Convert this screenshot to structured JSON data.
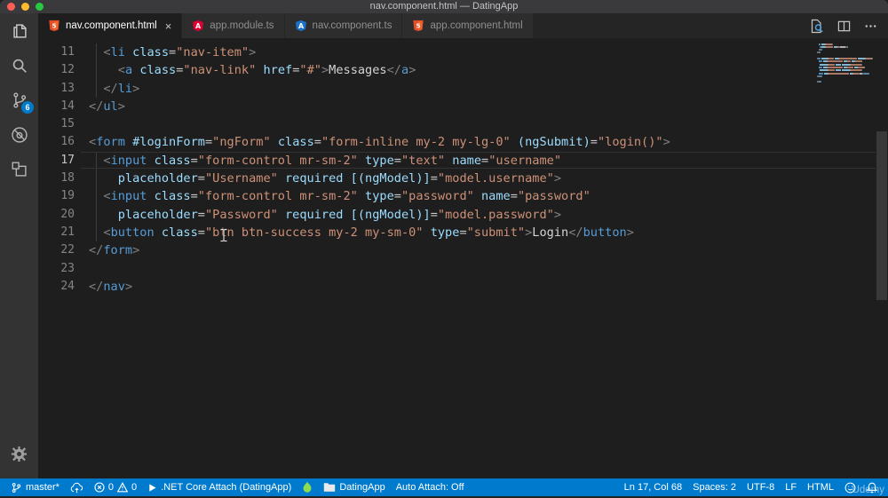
{
  "colors": {
    "accent": "#007acc",
    "editor_bg": "#1e1e1e",
    "activity_bg": "#333333",
    "tab_bg": "#2d2d2d",
    "tabbar_bg": "#252526",
    "titlebar_bg": "#3a3a3c",
    "tok": {
      "p": "#808080",
      "tag": "#569cd6",
      "attr": "#9cdcfe",
      "str": "#ce9178",
      "txt": "#d4d4d4",
      "eq": "#c8c8c8"
    },
    "html_icon": "#e44d26",
    "angular_red": "#dd0031",
    "angular_blue": "#1a73c9",
    "flame_green": "#8bdc4e"
  },
  "window": {
    "title": "nav.component.html — DatingApp"
  },
  "activity_bar": {
    "items": [
      {
        "name": "explorer",
        "icon": "files-icon"
      },
      {
        "name": "search",
        "icon": "search-icon"
      },
      {
        "name": "source-control",
        "icon": "source-control-icon",
        "badge": "6"
      },
      {
        "name": "debug",
        "icon": "debug-icon"
      },
      {
        "name": "extensions",
        "icon": "extensions-icon"
      }
    ],
    "bottom": [
      {
        "name": "settings",
        "icon": "gear-icon"
      }
    ]
  },
  "tab_bar": {
    "tabs": [
      {
        "label": "nav.component.html",
        "icon": "html-file-icon",
        "active": true,
        "close": "×"
      },
      {
        "label": "app.module.ts",
        "icon": "angular-red-icon",
        "active": false
      },
      {
        "label": "nav.component.ts",
        "icon": "angular-blue-icon",
        "active": false
      },
      {
        "label": "app.component.html",
        "icon": "html-file-icon",
        "active": false
      }
    ],
    "actions": [
      {
        "name": "open-preview",
        "icon": "preview-icon"
      },
      {
        "name": "split-editor",
        "icon": "split-editor-icon"
      },
      {
        "name": "more-actions",
        "icon": "ellipsis-icon"
      }
    ]
  },
  "editor": {
    "current_line": "17",
    "lines": [
      {
        "num": "11",
        "guide": true,
        "tokens": [
          [
            "ws",
            "  "
          ],
          [
            "p",
            "<"
          ],
          [
            "tag",
            "li"
          ],
          [
            "ws",
            " "
          ],
          [
            "attr",
            "class"
          ],
          [
            "eq",
            "="
          ],
          [
            "str",
            "\"nav-item\""
          ],
          [
            "p",
            ">"
          ]
        ]
      },
      {
        "num": "12",
        "guide": true,
        "tokens": [
          [
            "ws",
            "    "
          ],
          [
            "p",
            "<"
          ],
          [
            "tag",
            "a"
          ],
          [
            "ws",
            " "
          ],
          [
            "attr",
            "class"
          ],
          [
            "eq",
            "="
          ],
          [
            "str",
            "\"nav-link\""
          ],
          [
            "ws",
            " "
          ],
          [
            "attr",
            "href"
          ],
          [
            "eq",
            "="
          ],
          [
            "str",
            "\"#\""
          ],
          [
            "p",
            ">"
          ],
          [
            "txt",
            "Messages"
          ],
          [
            "p",
            "</"
          ],
          [
            "tag",
            "a"
          ],
          [
            "p",
            ">"
          ]
        ]
      },
      {
        "num": "13",
        "guide": true,
        "tokens": [
          [
            "ws",
            "  "
          ],
          [
            "p",
            "</"
          ],
          [
            "tag",
            "li"
          ],
          [
            "p",
            ">"
          ]
        ]
      },
      {
        "num": "14",
        "guide": false,
        "tokens": [
          [
            "p",
            "</"
          ],
          [
            "tag",
            "ul"
          ],
          [
            "p",
            ">"
          ]
        ]
      },
      {
        "num": "15",
        "guide": false,
        "tokens": []
      },
      {
        "num": "16",
        "guide": false,
        "tokens": [
          [
            "p",
            "<"
          ],
          [
            "tag",
            "form"
          ],
          [
            "ws",
            " "
          ],
          [
            "attr",
            "#loginForm"
          ],
          [
            "eq",
            "="
          ],
          [
            "str",
            "\"ngForm\""
          ],
          [
            "ws",
            " "
          ],
          [
            "attr",
            "class"
          ],
          [
            "eq",
            "="
          ],
          [
            "str",
            "\"form-inline my-2 my-lg-0\""
          ],
          [
            "ws",
            " "
          ],
          [
            "attr",
            "(ngSubmit)"
          ],
          [
            "eq",
            "="
          ],
          [
            "str",
            "\"login()\""
          ],
          [
            "p",
            ">"
          ]
        ]
      },
      {
        "num": "17",
        "guide": true,
        "tokens": [
          [
            "ws",
            "  "
          ],
          [
            "p",
            "<"
          ],
          [
            "tag",
            "input"
          ],
          [
            "ws",
            " "
          ],
          [
            "attr",
            "class"
          ],
          [
            "eq",
            "="
          ],
          [
            "str",
            "\"form-control mr-sm-2\""
          ],
          [
            "ws",
            " "
          ],
          [
            "attr",
            "type"
          ],
          [
            "eq",
            "="
          ],
          [
            "str",
            "\"text\""
          ],
          [
            "ws",
            " "
          ],
          [
            "attr",
            "name"
          ],
          [
            "eq",
            "="
          ],
          [
            "str",
            "\"username\""
          ]
        ]
      },
      {
        "num": "18",
        "guide": true,
        "tokens": [
          [
            "ws",
            "    "
          ],
          [
            "attr",
            "placeholder"
          ],
          [
            "eq",
            "="
          ],
          [
            "str",
            "\"Username\""
          ],
          [
            "ws",
            " "
          ],
          [
            "attr",
            "required"
          ],
          [
            "ws",
            " "
          ],
          [
            "attr",
            "[(ngModel)]"
          ],
          [
            "eq",
            "="
          ],
          [
            "str",
            "\"model.username\""
          ],
          [
            "p",
            ">"
          ]
        ]
      },
      {
        "num": "19",
        "guide": true,
        "tokens": [
          [
            "ws",
            "  "
          ],
          [
            "p",
            "<"
          ],
          [
            "tag",
            "input"
          ],
          [
            "ws",
            " "
          ],
          [
            "attr",
            "class"
          ],
          [
            "eq",
            "="
          ],
          [
            "str",
            "\"form-control mr-sm-2\""
          ],
          [
            "ws",
            " "
          ],
          [
            "attr",
            "type"
          ],
          [
            "eq",
            "="
          ],
          [
            "str",
            "\"password\""
          ],
          [
            "ws",
            " "
          ],
          [
            "attr",
            "name"
          ],
          [
            "eq",
            "="
          ],
          [
            "str",
            "\"password\""
          ]
        ]
      },
      {
        "num": "20",
        "guide": true,
        "tokens": [
          [
            "ws",
            "    "
          ],
          [
            "attr",
            "placeholder"
          ],
          [
            "eq",
            "="
          ],
          [
            "str",
            "\"Password\""
          ],
          [
            "ws",
            " "
          ],
          [
            "attr",
            "required"
          ],
          [
            "ws",
            " "
          ],
          [
            "attr",
            "[(ngModel)]"
          ],
          [
            "eq",
            "="
          ],
          [
            "str",
            "\"model.password\""
          ],
          [
            "p",
            ">"
          ]
        ]
      },
      {
        "num": "21",
        "guide": true,
        "tokens": [
          [
            "ws",
            "  "
          ],
          [
            "p",
            "<"
          ],
          [
            "tag",
            "button"
          ],
          [
            "ws",
            " "
          ],
          [
            "attr",
            "class"
          ],
          [
            "eq",
            "="
          ],
          [
            "str",
            "\"btn btn-success my-2 my-sm-0\""
          ],
          [
            "ws",
            " "
          ],
          [
            "attr",
            "type"
          ],
          [
            "eq",
            "="
          ],
          [
            "str",
            "\"submit\""
          ],
          [
            "p",
            ">"
          ],
          [
            "txt",
            "Login"
          ],
          [
            "p",
            "</"
          ],
          [
            "tag",
            "button"
          ],
          [
            "p",
            ">"
          ]
        ]
      },
      {
        "num": "22",
        "guide": false,
        "tokens": [
          [
            "p",
            "</"
          ],
          [
            "tag",
            "form"
          ],
          [
            "p",
            ">"
          ]
        ]
      },
      {
        "num": "23",
        "guide": false,
        "tokens": []
      },
      {
        "num": "24",
        "guide": false,
        "tokens": [
          [
            "p",
            "</"
          ],
          [
            "tag",
            "nav"
          ],
          [
            "p",
            ">"
          ]
        ]
      }
    ]
  },
  "status_bar": {
    "left": [
      {
        "name": "git-branch",
        "segments": [
          {
            "icon": "branch-icon"
          },
          {
            "text": "master*"
          }
        ]
      },
      {
        "name": "sync-changes",
        "segments": [
          {
            "icon": "cloud-upload-icon"
          }
        ]
      },
      {
        "name": "problems",
        "segments": [
          {
            "icon": "error-circle-icon"
          },
          {
            "text": "0"
          },
          {
            "icon": "warning-triangle-icon"
          },
          {
            "text": "0"
          }
        ]
      },
      {
        "name": "debug-config",
        "segments": [
          {
            "icon": "play-icon"
          },
          {
            "text": ".NET Core Attach (DatingApp)"
          }
        ]
      },
      {
        "name": "angular-status",
        "segments": [
          {
            "icon": "flame-icon"
          }
        ]
      },
      {
        "name": "workspace-folder",
        "segments": [
          {
            "icon": "folder-icon"
          },
          {
            "text": "DatingApp"
          }
        ]
      },
      {
        "name": "auto-attach",
        "segments": [
          {
            "text": "Auto Attach: Off"
          }
        ]
      }
    ],
    "right": [
      {
        "name": "cursor-position",
        "segments": [
          {
            "text": "Ln 17, Col 68"
          }
        ]
      },
      {
        "name": "indentation",
        "segments": [
          {
            "text": "Spaces: 2"
          }
        ]
      },
      {
        "name": "encoding",
        "segments": [
          {
            "text": "UTF-8"
          }
        ]
      },
      {
        "name": "eol",
        "segments": [
          {
            "text": "LF"
          }
        ]
      },
      {
        "name": "language-mode",
        "segments": [
          {
            "text": "HTML"
          }
        ]
      },
      {
        "name": "feedback",
        "segments": [
          {
            "icon": "smiley-icon"
          }
        ]
      },
      {
        "name": "notifications",
        "segments": [
          {
            "icon": "bell-icon"
          }
        ]
      }
    ]
  },
  "watermark": {
    "label": "Udemy"
  }
}
